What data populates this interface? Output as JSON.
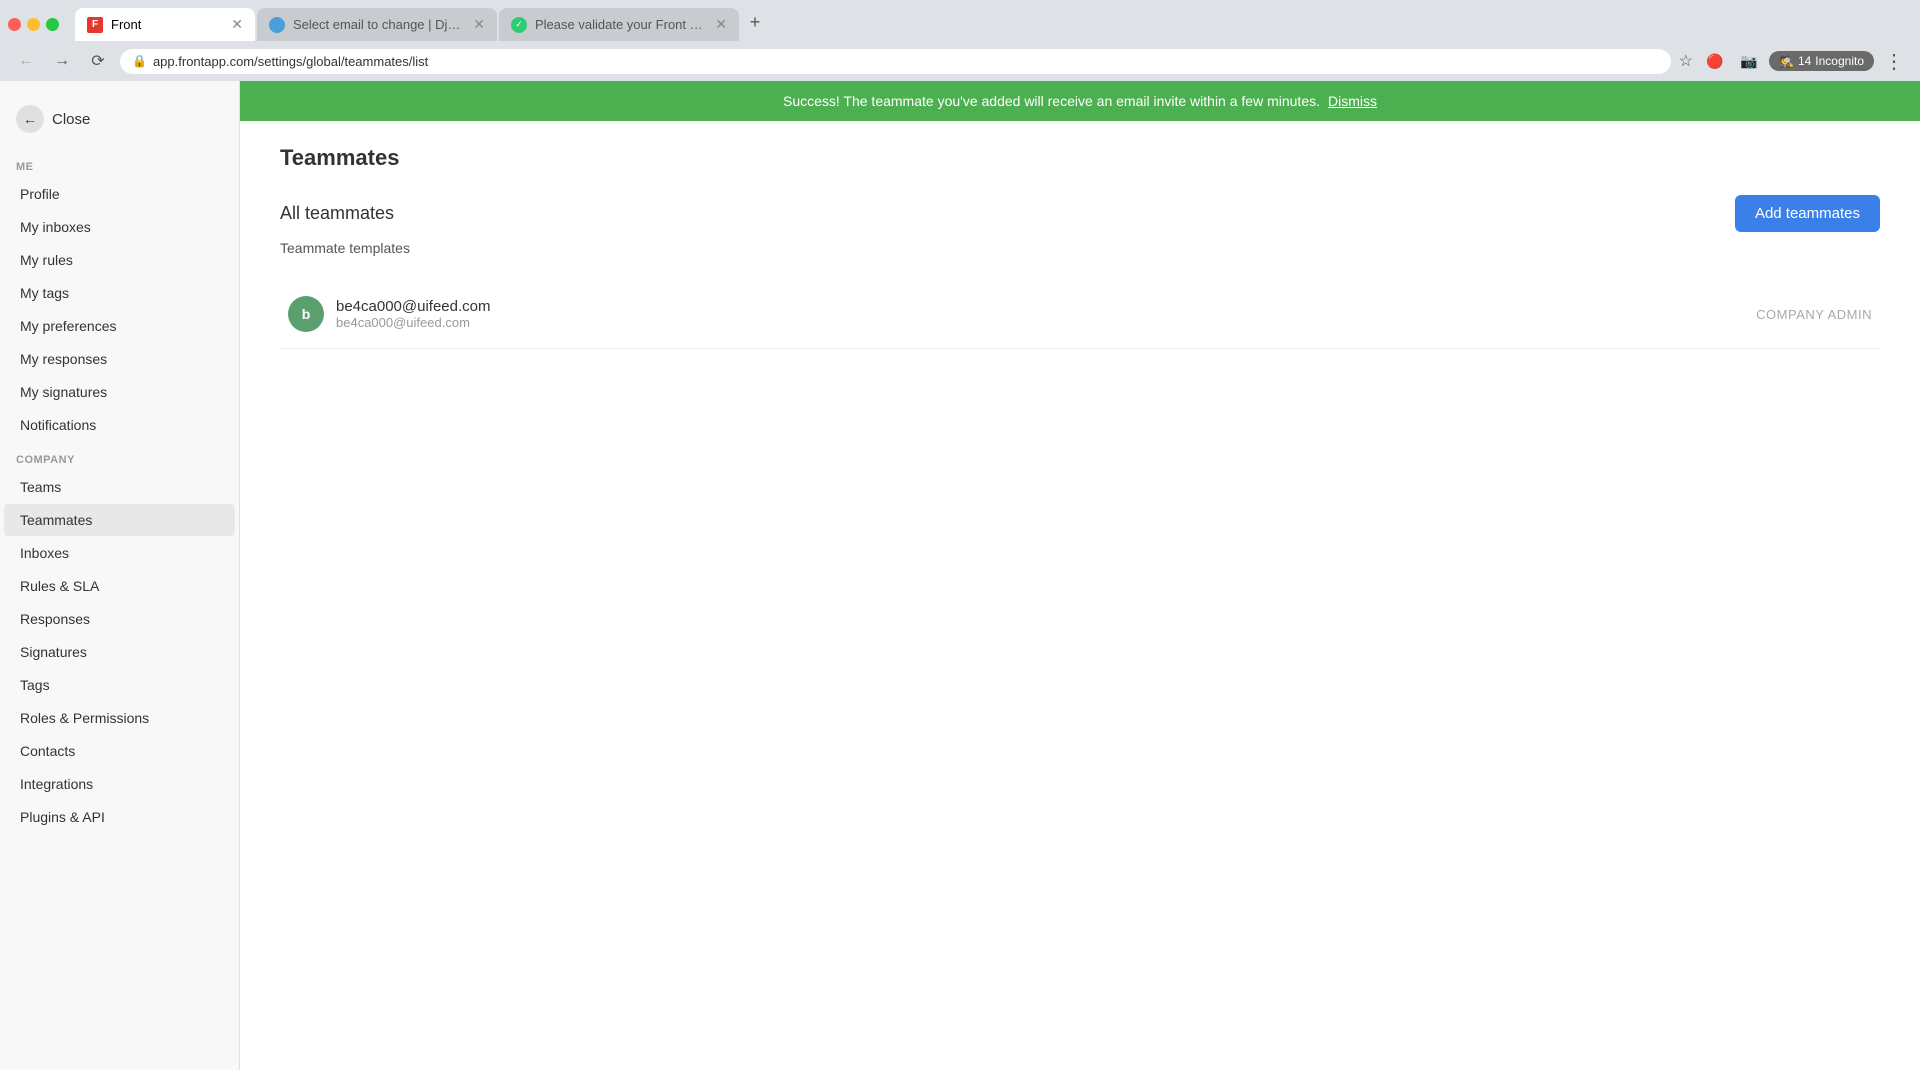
{
  "browser": {
    "tabs": [
      {
        "id": "tab1",
        "favicon_type": "front",
        "favicon_text": "F",
        "label": "Front",
        "active": true,
        "closable": true
      },
      {
        "id": "tab2",
        "favicon_type": "select",
        "favicon_text": "",
        "label": "Select email to change | Djang…",
        "active": false,
        "closable": true
      },
      {
        "id": "tab3",
        "favicon_type": "validate",
        "favicon_text": "✓",
        "label": "Please validate your Front acc…",
        "active": false,
        "closable": true
      }
    ],
    "url": "app.frontapp.com/settings/global/teammates/list",
    "incognito_label": "Incognito",
    "incognito_badge": "14"
  },
  "success_banner": {
    "message": "Success! The teammate you've added will receive an email invite within a few minutes.",
    "dismiss_label": "Dismiss"
  },
  "sidebar": {
    "close_label": "Close",
    "me_section": "ME",
    "me_items": [
      {
        "id": "profile",
        "label": "Profile"
      },
      {
        "id": "my-inboxes",
        "label": "My inboxes"
      },
      {
        "id": "my-rules",
        "label": "My rules"
      },
      {
        "id": "my-tags",
        "label": "My tags"
      },
      {
        "id": "my-preferences",
        "label": "My preferences"
      },
      {
        "id": "my-responses",
        "label": "My responses"
      },
      {
        "id": "my-signatures",
        "label": "My signatures"
      },
      {
        "id": "notifications",
        "label": "Notifications"
      }
    ],
    "company_section": "COMPANY",
    "company_items": [
      {
        "id": "teams",
        "label": "Teams"
      },
      {
        "id": "teammates",
        "label": "Teammates",
        "active": true
      },
      {
        "id": "inboxes",
        "label": "Inboxes"
      },
      {
        "id": "rules-sla",
        "label": "Rules & SLA"
      },
      {
        "id": "responses",
        "label": "Responses"
      },
      {
        "id": "signatures",
        "label": "Signatures"
      },
      {
        "id": "tags",
        "label": "Tags"
      },
      {
        "id": "roles-permissions",
        "label": "Roles & Permissions"
      },
      {
        "id": "contacts",
        "label": "Contacts"
      },
      {
        "id": "integrations",
        "label": "Integrations"
      },
      {
        "id": "plugins-api",
        "label": "Plugins & API"
      }
    ]
  },
  "content": {
    "page_title": "Teammates",
    "all_teammates_label": "All teammates",
    "add_teammates_label": "Add teammates",
    "template_link": "Teammate templates",
    "teammates": [
      {
        "id": "tm1",
        "avatar_initials": "b",
        "avatar_color": "#5a9f6e",
        "name": "be4ca000@uifeed.com",
        "email": "be4ca000@uifeed.com",
        "role": "COMPANY ADMIN"
      }
    ]
  }
}
